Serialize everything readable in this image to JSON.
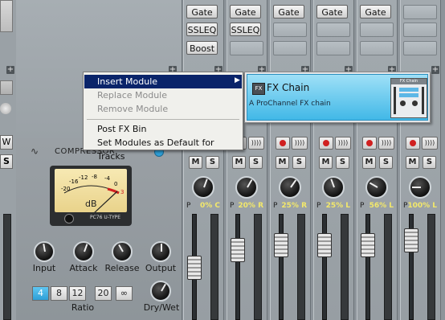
{
  "tracks": [
    {
      "modules": [
        "Gate",
        "SSLEQ",
        "Boost"
      ],
      "pan": "0% C"
    },
    {
      "modules": [
        "Gate",
        "SSLEQ"
      ],
      "pan": "20% R"
    },
    {
      "modules": [
        "Gate"
      ],
      "pan": "25% R"
    },
    {
      "modules": [
        "Gate"
      ],
      "pan": "25% L"
    },
    {
      "modules": [
        "Gate"
      ],
      "pan": "56% L"
    },
    {
      "modules": [],
      "pan": "100% L"
    }
  ],
  "buttons": {
    "mute": "M",
    "solo": "S",
    "pan_prefix": "P",
    "plus": "+"
  },
  "left_strip": {
    "w_label": "W",
    "s_label": "S"
  },
  "compressor": {
    "title": "COMPRESSOR",
    "vu_unit": "dB",
    "vu_scale": [
      "-20",
      "-16",
      "-12",
      "-8",
      "-4",
      "0",
      "3"
    ],
    "vu_model": "PC76 U-TYPE",
    "knobs": [
      "Input",
      "Attack",
      "Release",
      "Output",
      "Dry/Wet"
    ],
    "ratio_label": "Ratio",
    "ratio_options": [
      "4",
      "8",
      "12",
      "20",
      "∞"
    ],
    "ratio_selected": "4"
  },
  "context_menu": {
    "items": [
      {
        "label": "Insert Module",
        "state": "highlighted",
        "submenu": true
      },
      {
        "label": "Replace Module",
        "state": "disabled"
      },
      {
        "label": "Remove Module",
        "state": "disabled"
      },
      {
        "label": "Post FX Bin",
        "state": "normal"
      },
      {
        "label": "Set Modules as Default for Tracks",
        "state": "normal"
      }
    ]
  },
  "submenu": {
    "icon_text": "FX",
    "title": "FX Chain",
    "description": "A ProChannel FX chain",
    "preview_title": "FX Chain"
  },
  "colors": {
    "menu_highlight": "#0a246a",
    "fx_card": "#41b8e7",
    "ratio_active": "#2e9fd7",
    "record": "#d02020",
    "pan_text": "#f3e86a"
  }
}
